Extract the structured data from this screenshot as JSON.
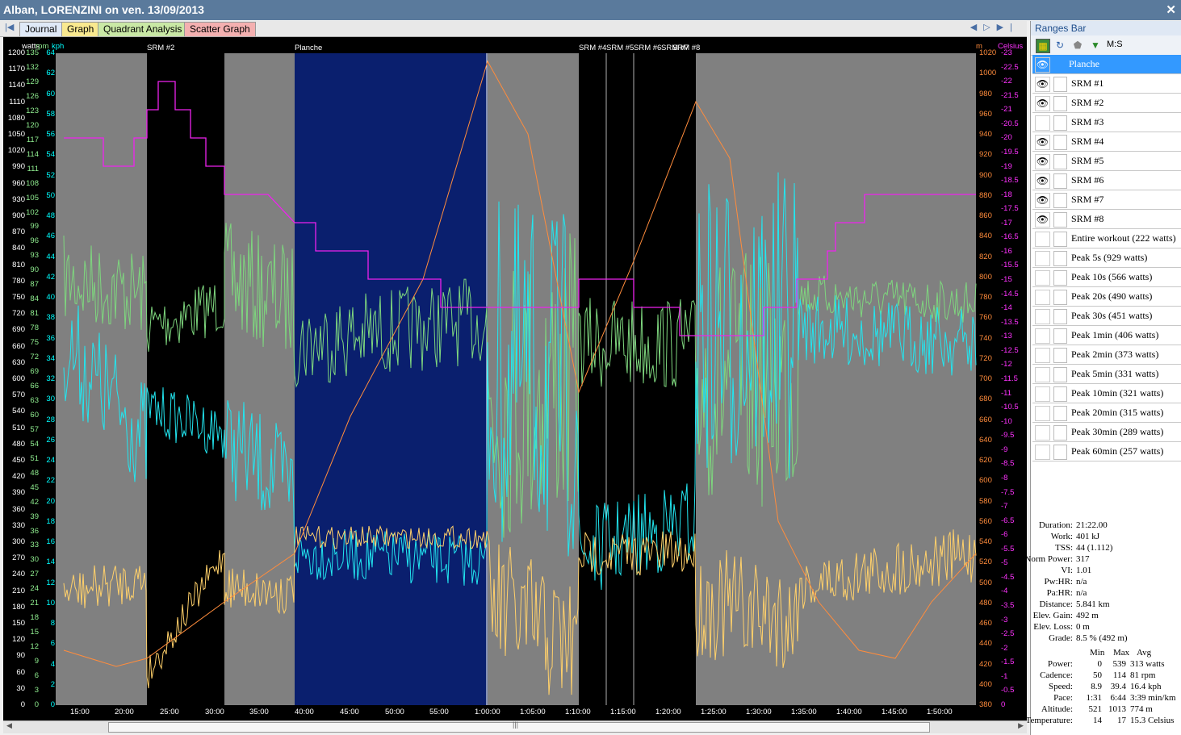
{
  "window": {
    "title": "Alban, LORENZINI on ven. 13/09/2013"
  },
  "tabs": [
    {
      "label": "Journal",
      "color": "#dfe9f7"
    },
    {
      "label": "Graph",
      "color": "#f9e98f"
    },
    {
      "label": "Quadrant Analysis",
      "color": "#c9e8a5"
    },
    {
      "label": "Scatter Graph",
      "color": "#f4b0b0"
    }
  ],
  "graph": {
    "axes": {
      "watts": {
        "title": "watts",
        "ticks": [
          "1200",
          "1170",
          "1140",
          "1110",
          "1080",
          "1050",
          "1020",
          "990",
          "960",
          "930",
          "900",
          "870",
          "840",
          "810",
          "780",
          "750",
          "720",
          "690",
          "660",
          "630",
          "600",
          "570",
          "540",
          "510",
          "480",
          "450",
          "420",
          "390",
          "360",
          "330",
          "300",
          "270",
          "240",
          "210",
          "180",
          "150",
          "120",
          "90",
          "60",
          "30",
          "0"
        ],
        "color": "#ffffff"
      },
      "rpm": {
        "title": "rpm",
        "ticks": [
          "135",
          "132",
          "129",
          "126",
          "123",
          "120",
          "117",
          "114",
          "111",
          "108",
          "105",
          "102",
          "99",
          "96",
          "93",
          "90",
          "87",
          "84",
          "81",
          "78",
          "75",
          "72",
          "69",
          "66",
          "63",
          "60",
          "57",
          "54",
          "51",
          "48",
          "45",
          "42",
          "39",
          "36",
          "33",
          "30",
          "27",
          "24",
          "21",
          "18",
          "15",
          "12",
          "9",
          "6",
          "3",
          "0"
        ],
        "color": "#90ee90"
      },
      "kph": {
        "title": "kph",
        "ticks": [
          "64",
          "62",
          "60",
          "58",
          "56",
          "54",
          "52",
          "50",
          "48",
          "46",
          "44",
          "42",
          "40",
          "38",
          "36",
          "34",
          "32",
          "30",
          "28",
          "26",
          "24",
          "22",
          "20",
          "18",
          "16",
          "14",
          "12",
          "10",
          "8",
          "6",
          "4",
          "2",
          "0"
        ],
        "color": "#00ffff"
      },
      "m": {
        "title": "m",
        "ticks": [
          "1020",
          "1000",
          "980",
          "960",
          "940",
          "920",
          "900",
          "880",
          "860",
          "840",
          "820",
          "800",
          "780",
          "760",
          "740",
          "720",
          "700",
          "680",
          "660",
          "640",
          "620",
          "600",
          "580",
          "560",
          "540",
          "520",
          "500",
          "480",
          "460",
          "440",
          "420",
          "400",
          "380"
        ],
        "color": "#ff8c3c"
      },
      "celsius": {
        "title": "Celsius",
        "ticks": [
          "-23",
          "-22.5",
          "-22",
          "-21.5",
          "-21",
          "-20.5",
          "-20",
          "-19.5",
          "-19",
          "-18.5",
          "-18",
          "-17.5",
          "-17",
          "-16.5",
          "-16",
          "-15.5",
          "-15",
          "-14.5",
          "-14",
          "-13.5",
          "-13",
          "-12.5",
          "-12",
          "-11.5",
          "-11",
          "-10.5",
          "-10",
          "-9.5",
          "-9",
          "-8.5",
          "-8",
          "-7.5",
          "-7",
          "-6.5",
          "-6",
          "-5.5",
          "-5",
          "-4.5",
          "-4",
          "-3.5",
          "-3",
          "-2.5",
          "-2",
          "-1.5",
          "-1",
          "-0.5",
          "0"
        ],
        "color": "#ff33ff"
      }
    },
    "time_ticks": [
      "15:00",
      "20:00",
      "25:00",
      "30:00",
      "35:00",
      "40:00",
      "45:00",
      "50:00",
      "55:00",
      "1:00:00",
      "1:05:00",
      "1:10:00",
      "1:15:00",
      "1:20:00",
      "1:25:00",
      "1:30:00",
      "1:35:00",
      "1:40:00",
      "1:45:00",
      "1:50:00"
    ],
    "range_labels": [
      "SRM #2",
      "Planche",
      "SRM #4",
      "SRM #5",
      "SRM #6",
      "SRM #7",
      "SRM #8"
    ],
    "colors": {
      "background": "#808080",
      "selected_range": "#0a1f6e",
      "srm_range": "#000000",
      "power": "#ffd06a",
      "cadence": "#7ed67e",
      "speed": "#22e6f0",
      "altitude": "#ff8c3c",
      "temperature": "#ee22ee"
    }
  },
  "ranges_bar": {
    "title": "Ranges Bar",
    "mode_label": "M:S",
    "items": [
      {
        "label": "Planche",
        "visible": true,
        "selected": true
      },
      {
        "label": "SRM #1",
        "visible": true
      },
      {
        "label": "SRM #2",
        "visible": true
      },
      {
        "label": "SRM #3",
        "visible": false
      },
      {
        "label": "SRM #4",
        "visible": true
      },
      {
        "label": "SRM #5",
        "visible": true
      },
      {
        "label": "SRM #6",
        "visible": true
      },
      {
        "label": "SRM #7",
        "visible": true
      },
      {
        "label": "SRM #8",
        "visible": true
      },
      {
        "label": "Entire workout (222 watts)",
        "visible": false
      },
      {
        "label": "Peak 5s (929 watts)",
        "visible": false
      },
      {
        "label": "Peak 10s (566 watts)",
        "visible": false
      },
      {
        "label": "Peak 20s (490 watts)",
        "visible": false
      },
      {
        "label": "Peak 30s (451 watts)",
        "visible": false
      },
      {
        "label": "Peak 1min (406 watts)",
        "visible": false
      },
      {
        "label": "Peak 2min (373 watts)",
        "visible": false
      },
      {
        "label": "Peak 5min (331 watts)",
        "visible": false
      },
      {
        "label": "Peak 10min (321 watts)",
        "visible": false
      },
      {
        "label": "Peak 20min (315 watts)",
        "visible": false
      },
      {
        "label": "Peak 30min (289 watts)",
        "visible": false
      },
      {
        "label": "Peak 60min (257 watts)",
        "visible": false
      }
    ]
  },
  "stats": {
    "summary": [
      {
        "label": "Duration:",
        "value": "21:22.00"
      },
      {
        "label": "Work:",
        "value": "401 kJ"
      },
      {
        "label": "TSS:",
        "value": "44 (1.112)"
      },
      {
        "label": "Norm Power:",
        "value": "317"
      },
      {
        "label": "VI:",
        "value": "1.01"
      },
      {
        "label": "Pw:HR:",
        "value": "n/a"
      },
      {
        "label": "Pa:HR:",
        "value": "n/a"
      },
      {
        "label": "Distance:",
        "value": "5.841 km"
      },
      {
        "label": "Elev. Gain:",
        "value": "492 m"
      },
      {
        "label": "Elev. Loss:",
        "value": "0 m"
      },
      {
        "label": "Grade:",
        "value": "8.5 % (492 m)"
      }
    ],
    "table_headers": [
      "Min",
      "Max",
      "Avg"
    ],
    "table": [
      {
        "label": "Power:",
        "min": "0",
        "max": "539",
        "avg": "313 watts"
      },
      {
        "label": "Cadence:",
        "min": "50",
        "max": "114",
        "avg": "81 rpm"
      },
      {
        "label": "Speed:",
        "min": "8.9",
        "max": "39.4",
        "avg": "16.4 kph"
      },
      {
        "label": "Pace:",
        "min": "1:31",
        "max": "6:44",
        "avg": "3:39 min/km"
      },
      {
        "label": "Altitude:",
        "min": "521",
        "max": "1013",
        "avg": "774 m"
      },
      {
        "label": "Temperature:",
        "min": "14",
        "max": "17",
        "avg": "15.3 Celsius"
      }
    ]
  }
}
